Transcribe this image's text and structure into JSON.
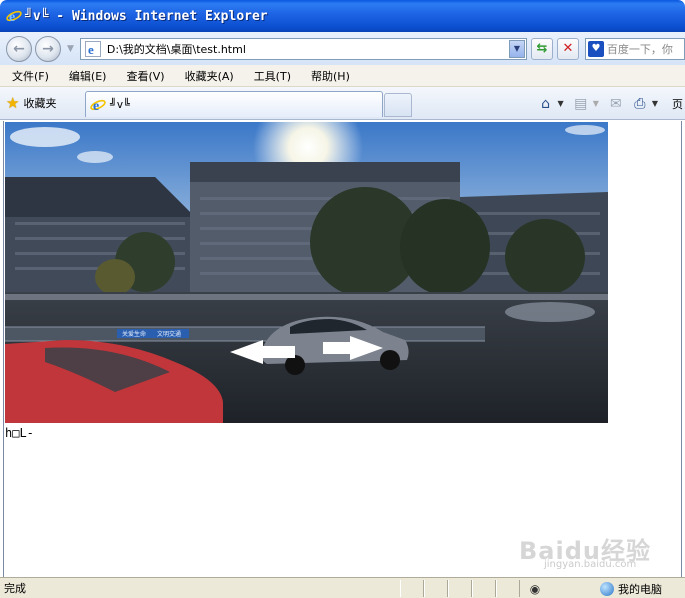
{
  "window": {
    "title": "╝v╚ - Windows Internet Explorer"
  },
  "address_bar": {
    "url": "D:\\我的文档\\桌面\\test.html",
    "search_placeholder": "百度一下，你"
  },
  "menu": {
    "items": [
      "文件(F)",
      "编辑(E)",
      "查看(V)",
      "收藏夹(A)",
      "工具(T)",
      "帮助(H)"
    ]
  },
  "favorites_bar": {
    "label": "收藏夹",
    "tab_title": "╝v╚",
    "page_menu_label": "页"
  },
  "page": {
    "text": "h□L-",
    "image_signs": [
      "关爱生命",
      "文明交通"
    ],
    "watermark": "Baidu经验",
    "watermark_sub": "jingyan.baidu.com"
  },
  "status_bar": {
    "status": "完成",
    "zone": "我的电脑"
  },
  "icons": {
    "back": "back-arrow-icon",
    "forward": "forward-arrow-icon",
    "refresh": "refresh-icon",
    "stop": "stop-icon",
    "home": "home-icon",
    "feeds": "rss-feed-icon",
    "mail": "mail-icon",
    "print": "printer-icon"
  },
  "colors": {
    "titlebar": "#0b4fd0",
    "chrome": "#dfe8f5",
    "statusbar": "#ece9d8"
  }
}
